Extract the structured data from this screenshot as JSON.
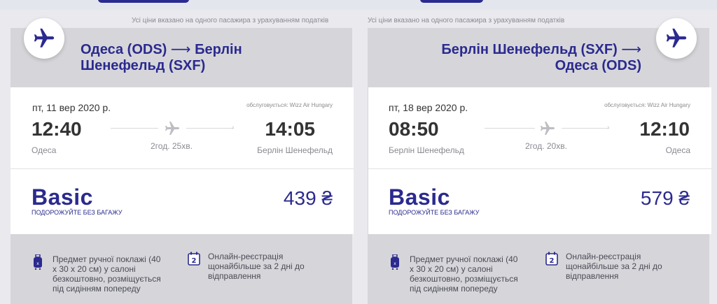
{
  "notice": "Усі ціни вказано на одного пасажира з урахуванням податків",
  "colors": {
    "brand": "#2b2a8f",
    "card_bg": "#d6d6da",
    "panel_bg": "#ffffff"
  },
  "icons": {
    "plane": "plane-icon",
    "luggage": "luggage-icon",
    "calendar": "calendar-icon"
  },
  "outbound": {
    "route_from": "Одеса (ODS)",
    "route_arrow": "⟶",
    "route_to": "Берлін",
    "route_line2": "Шенефельд (SXF)",
    "date": "пт, 11 вер 2020 р.",
    "operated_by": "обслуговується: Wizz Air Hungary",
    "depart_time": "12:40",
    "arrive_time": "14:05",
    "depart_city": "Одеса",
    "arrive_city": "Берлін Шенефельд",
    "duration": "2год. 25хв.",
    "fare_name": "Basic",
    "fare_sub": "ПОДОРОЖУЙТЕ БЕЗ БАГАЖУ",
    "price": "439 ₴"
  },
  "inbound": {
    "route_line1": "Берлін Шенефельд (SXF)",
    "route_arrow": "⟶",
    "route_line2": "Одеса (ODS)",
    "date": "пт, 18 вер 2020 р.",
    "operated_by": "обслуговується: Wizz Air Hungary",
    "depart_time": "08:50",
    "arrive_time": "12:10",
    "depart_city": "Берлін Шенефельд",
    "arrive_city": "Одеса",
    "duration": "2год. 20хв.",
    "fare_name": "Basic",
    "fare_sub": "ПОДОРОЖУЙТЕ БЕЗ БАГАЖУ",
    "price": "579 ₴"
  },
  "features": {
    "hand_luggage": [
      "Предмет ручної поклажі (40",
      "x 30 x 20 см) у салоні",
      "безкоштовно, розміщується",
      "під сидінням попереду"
    ],
    "checkin": [
      "Онлайн-реєстрація",
      "щонайбільше за 2 дні до",
      "відправлення"
    ],
    "calendar_number": "2"
  }
}
